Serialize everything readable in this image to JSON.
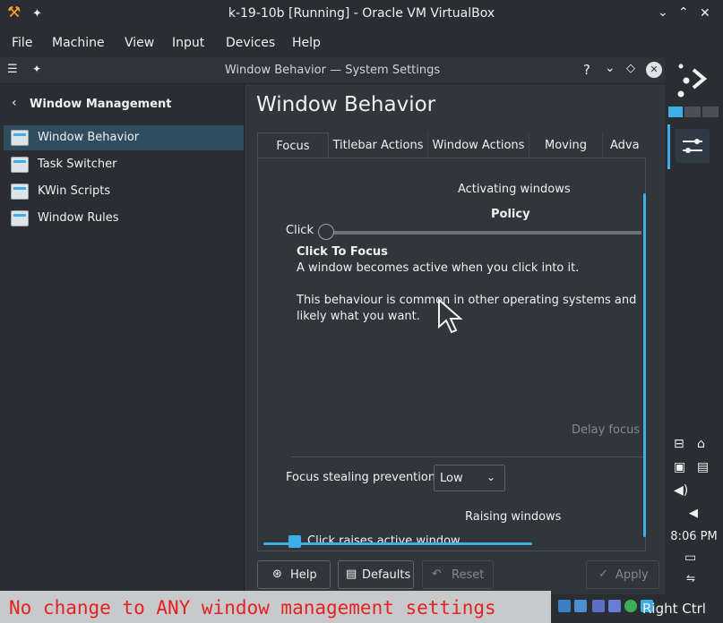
{
  "host": {
    "title": "k-19-10b [Running] - Oracle VM VirtualBox",
    "menu": [
      "File",
      "Machine",
      "View",
      "Input",
      "Devices",
      "Help"
    ]
  },
  "window": {
    "title": "Window Behavior — System Settings",
    "controls": {
      "help": "?",
      "minimize": "⌄",
      "keep_above": "◇",
      "close": "✕"
    }
  },
  "sidebar": {
    "back_label": "Window Management",
    "items": [
      {
        "label": "Window Behavior",
        "active": true
      },
      {
        "label": "Task Switcher",
        "active": false
      },
      {
        "label": "KWin Scripts",
        "active": false
      },
      {
        "label": "Window Rules",
        "active": false
      }
    ]
  },
  "main": {
    "title": "Window Behavior",
    "tabs": [
      "Focus",
      "Titlebar Actions",
      "Window Actions",
      "Moving",
      "Adva"
    ],
    "active_tab": "Focus",
    "activating": {
      "heading": "Activating windows",
      "policy_label": "Policy",
      "slider_left_label": "Click",
      "slider_level": 0,
      "policy_name": "Click To Focus",
      "line1": "A window becomes active when you click into it.",
      "line2": "This behaviour is common in other operating systems and",
      "line3": "likely what you want.",
      "delay_focus_label": "Delay focus"
    },
    "focus_stealing": {
      "label": "Focus stealing prevention",
      "value": "Low"
    },
    "raising": {
      "heading": "Raising windows",
      "checkbox_label": "Click raises active window",
      "checked": true
    }
  },
  "buttons": {
    "help": "Help",
    "defaults": "Defaults",
    "reset": "Reset",
    "apply": "Apply"
  },
  "panel": {
    "clock": "8:06 PM"
  },
  "overlay": {
    "caption": "No change to ANY window management settings"
  },
  "statusbar": {
    "host_key": "Right Ctrl"
  },
  "colors": {
    "accent": "#3daee9",
    "caption_text": "#e52222"
  }
}
